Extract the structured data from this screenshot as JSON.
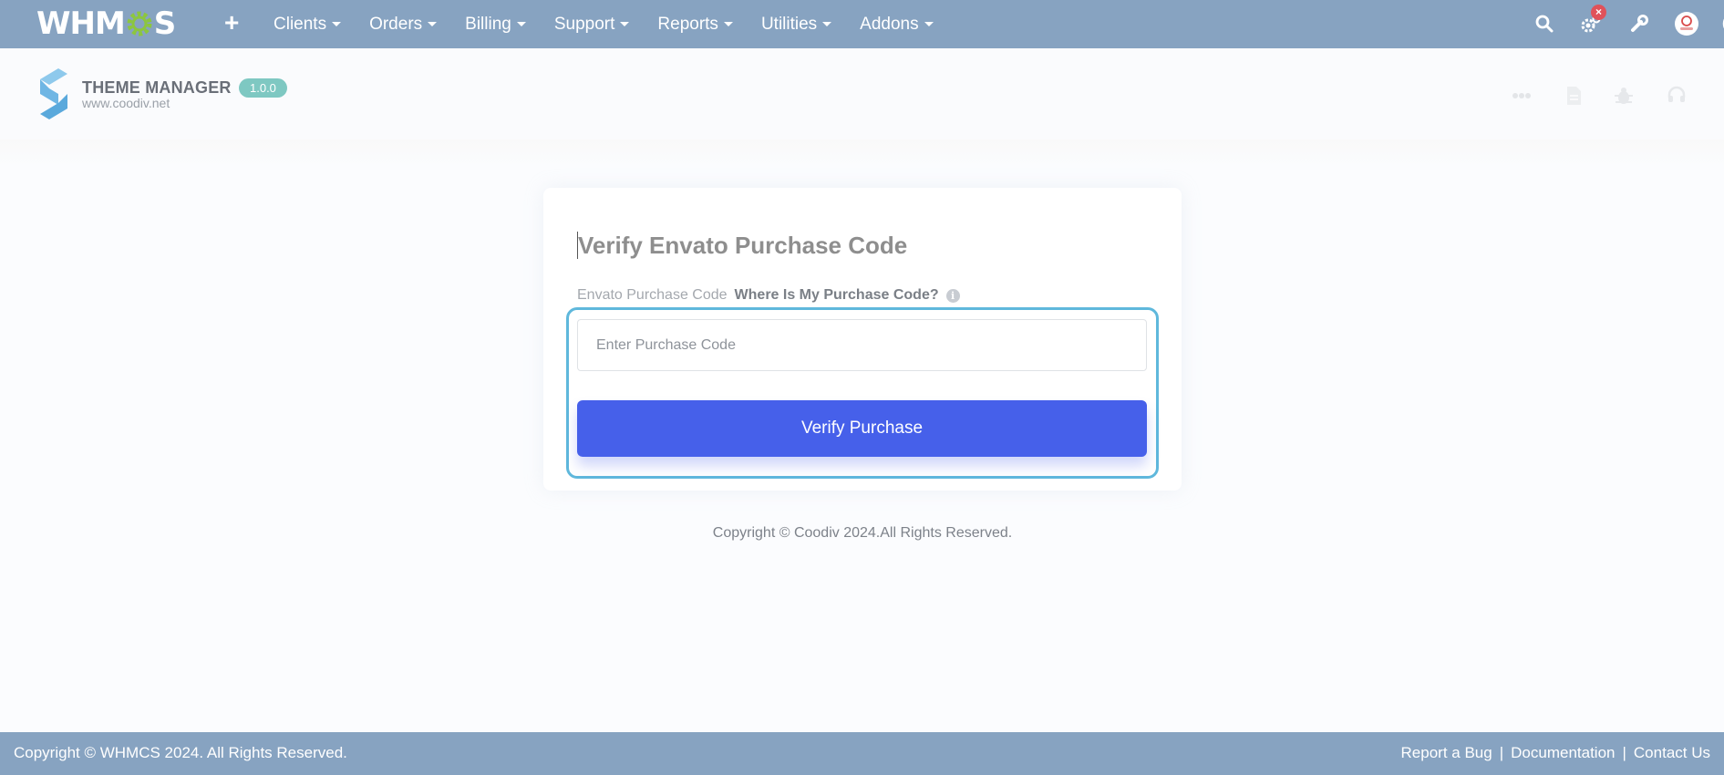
{
  "topnav": {
    "brand": [
      "WHM",
      "S"
    ],
    "plus_label": "+",
    "menu": [
      {
        "label": "Clients"
      },
      {
        "label": "Orders"
      },
      {
        "label": "Billing"
      },
      {
        "label": "Support"
      },
      {
        "label": "Reports"
      },
      {
        "label": "Utilities"
      },
      {
        "label": "Addons"
      }
    ],
    "alert_badge": "×",
    "icons": [
      "search-icon",
      "gears-icon",
      "wrench-icon",
      "avatar",
      "help-icon"
    ]
  },
  "addon": {
    "title": "THEME MANAGER",
    "version": "1.0.0",
    "url": "www.coodiv.net",
    "header_icons": [
      "dots-icon",
      "document-icon",
      "bug-icon",
      "headset-icon"
    ]
  },
  "card": {
    "title": "Verify Envato Purchase Code",
    "label": "Envato Purchase Code",
    "help_link": "Where Is My Purchase Code?",
    "info_glyph": "i",
    "input_placeholder": "Enter Purchase Code",
    "input_value": "",
    "button_label": "Verify Purchase"
  },
  "copyright": "Copyright © Coodiv 2024.All Rights Reserved.",
  "footer": {
    "left": "Copyright © WHMCS 2024. All Rights Reserved.",
    "links": [
      {
        "label": "Report a Bug"
      },
      {
        "label": "Documentation"
      },
      {
        "label": "Contact Us"
      }
    ],
    "separator": "|"
  },
  "colors": {
    "nav_bg": "#87a3c1",
    "primary": "#4660ea",
    "focus": "#5fb8dc",
    "version_badge": "#7ec8c2",
    "alert": "#e0525a"
  }
}
